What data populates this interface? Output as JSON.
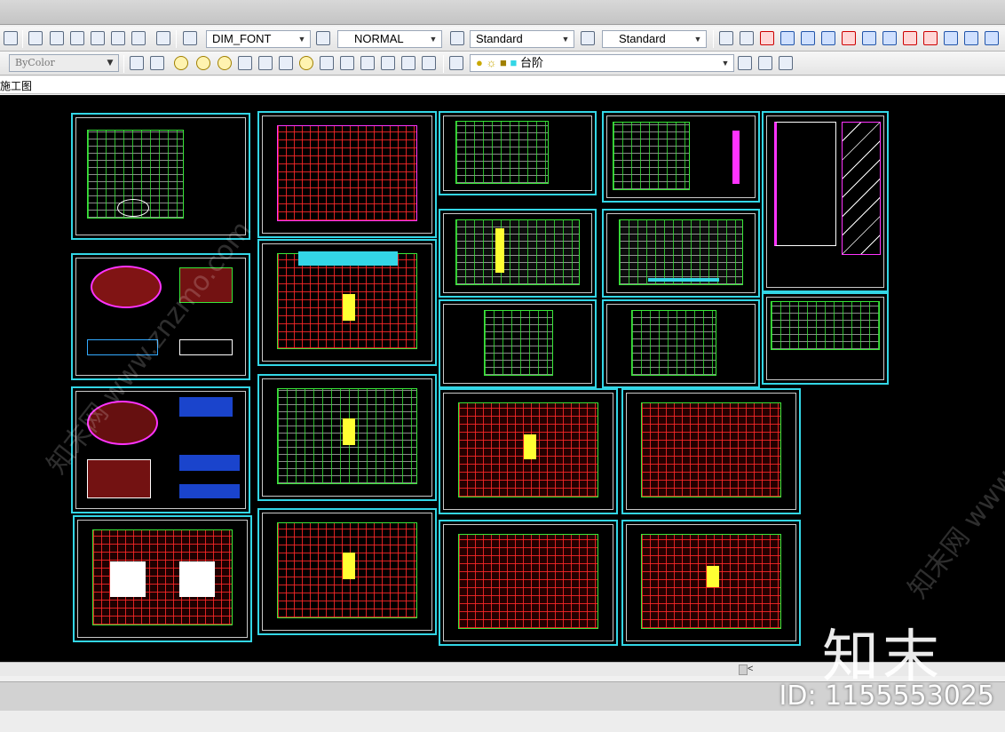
{
  "toolbar_top": {
    "dim_style": "DIM_FONT",
    "text_style": "NORMAL",
    "table_style": "Standard",
    "multileader_style": "Standard",
    "help_icon": "help-icon"
  },
  "toolbar_properties": {
    "linetype": "ByColor",
    "layer": "台阶"
  },
  "tab": {
    "label": "施工图"
  },
  "scrollbar": {
    "arrow": "<"
  },
  "watermark": {
    "logo": "知末",
    "id": "ID: 1155553025",
    "faint_text": "知末网 www.znzmo.com"
  },
  "colors": {
    "sheet_border": "#33d6e6",
    "plan_grid": "#ff2828",
    "line_green": "#39e639",
    "accent_magenta": "#ff33ff",
    "accent_yellow": "#ffff33"
  }
}
